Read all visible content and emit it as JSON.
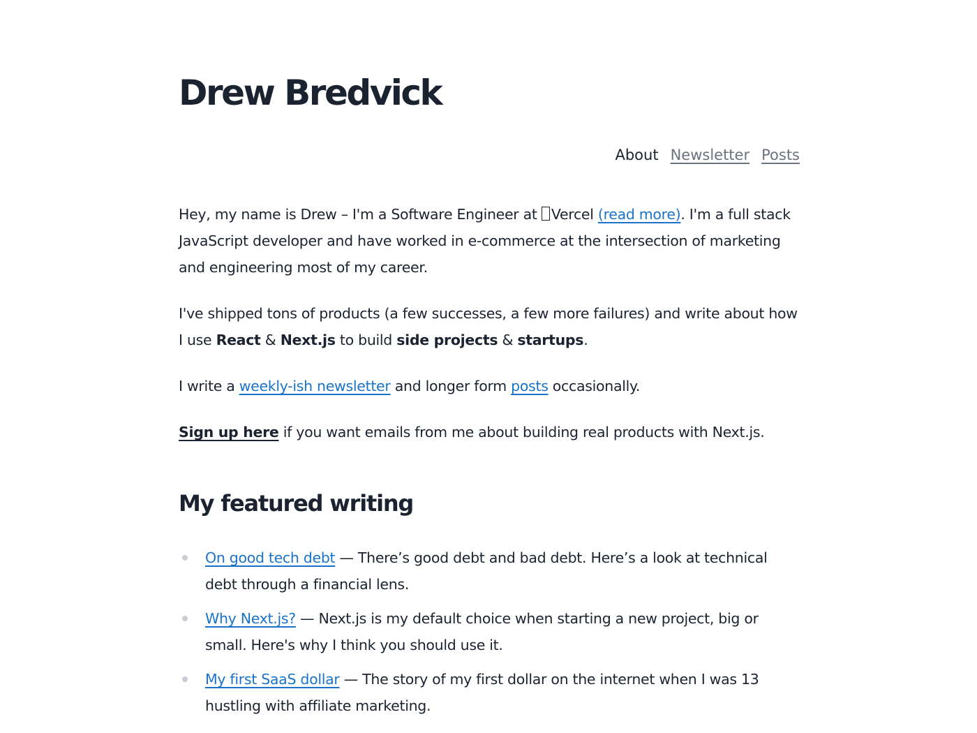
{
  "header": {
    "title": "Drew Bredvick"
  },
  "nav": {
    "items": [
      {
        "label": "About",
        "active": true
      },
      {
        "label": "Newsletter",
        "active": false
      },
      {
        "label": "Posts",
        "active": false
      }
    ]
  },
  "intro": {
    "p1_before": "Hey, my name is Drew – I'm a Software Engineer at ",
    "p1_company": "Vercel ",
    "p1_link": "(read more)",
    "p1_after": ". I'm a full stack JavaScript developer and have worked in e-commerce at the intersection of marketing and engineering most of my career.",
    "p2_before": "I've shipped tons of products (a few successes, a few more failures) and write about how I use ",
    "p2_bold1": "React",
    "p2_amp1": " & ",
    "p2_bold2": "Next.js",
    "p2_mid": " to build ",
    "p2_bold3": "side projects",
    "p2_amp2": " & ",
    "p2_bold4": "startups",
    "p2_end": ".",
    "p3_before": "I write a ",
    "p3_link1": "weekly-ish newsletter",
    "p3_mid": " and longer form ",
    "p3_link2": "posts",
    "p3_after": " occasionally.",
    "p4_link": "Sign up here",
    "p4_after": " if you want emails from me about building real products with Next.js."
  },
  "featured": {
    "heading": "My featured writing",
    "items": [
      {
        "link": "On good tech debt",
        "desc": " — There’s good debt and bad debt. Here’s a look at technical debt through a financial lens."
      },
      {
        "link": "Why Next.js?",
        "desc": " — Next.js is my default choice when starting a new project, big or small. Here's why I think you should use it."
      },
      {
        "link": "My first SaaS dollar",
        "desc": " — The story of my first dollar on the internet when I was 13 hustling with affiliate marketing."
      }
    ]
  },
  "colors": {
    "text": "#1c2330",
    "link": "#1a73c9",
    "nav_inactive": "#6b7280",
    "bullet": "#c9cdd3"
  }
}
